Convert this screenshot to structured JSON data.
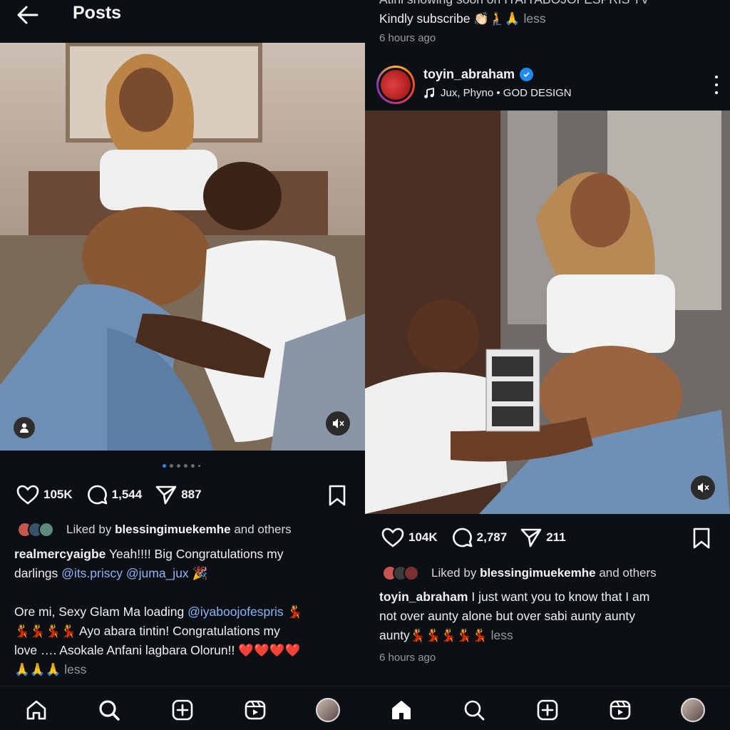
{
  "left": {
    "header": {
      "title": "Posts"
    },
    "post": {
      "likes": "105K",
      "comments": "1,544",
      "shares": "887",
      "liked_by_prefix": "Liked by",
      "liked_by_user": "blessingimuekemhe",
      "liked_by_suffix": "and others",
      "caption_user": "realmercyaigbe",
      "caption_line1": "Yeah!!!! Big Congratulations my",
      "caption_line2_pre": "darlings",
      "mention1": "@its.priscy",
      "mention2": "@juma_jux",
      "caption_emoji1": "🎉",
      "caption_line3_pre": "Ore mi, Sexy Glam Ma loading",
      "mention3": "@iyaboojofespris",
      "caption_emoji2": "💃",
      "caption_line4": "💃💃💃💃 Ayo abara tintin! Congratulations my",
      "caption_line5": "love …. Asokale Anfani lagbara Olorun!! ❤️❤️❤️❤️",
      "caption_line6": "🙏🙏🙏",
      "less": "less"
    }
  },
  "right": {
    "top_caption_partial": "Atinl showing soon on IYAIYABOJOFESPRIS TV",
    "top_caption_line2": "Kindly subscribe 👏🏻🧎🙏",
    "top_less": "less",
    "top_timestamp": "6 hours ago",
    "post": {
      "username": "toyin_abraham",
      "music": "Jux, Phyno • GOD DESIGN",
      "likes": "104K",
      "comments": "2,787",
      "shares": "211",
      "liked_by_prefix": "Liked by",
      "liked_by_user": "blessingimuekemhe",
      "liked_by_suffix": "and others",
      "caption_user": "toyin_abraham",
      "caption_line1": "I just want you to know that I am",
      "caption_line2": "not over aunty alone but over sabi aunty aunty",
      "caption_line3": "aunty💃💃💃💃💃",
      "less": "less",
      "timestamp": "6 hours ago"
    }
  },
  "nav": [
    "home-icon",
    "search-icon",
    "create-icon",
    "reels-icon",
    "profile-avatar"
  ],
  "colors": {
    "background": "#0c0f14",
    "mention": "#8fb3f5",
    "verified": "#1d8cf0",
    "active_dot": "#3b82f6"
  }
}
